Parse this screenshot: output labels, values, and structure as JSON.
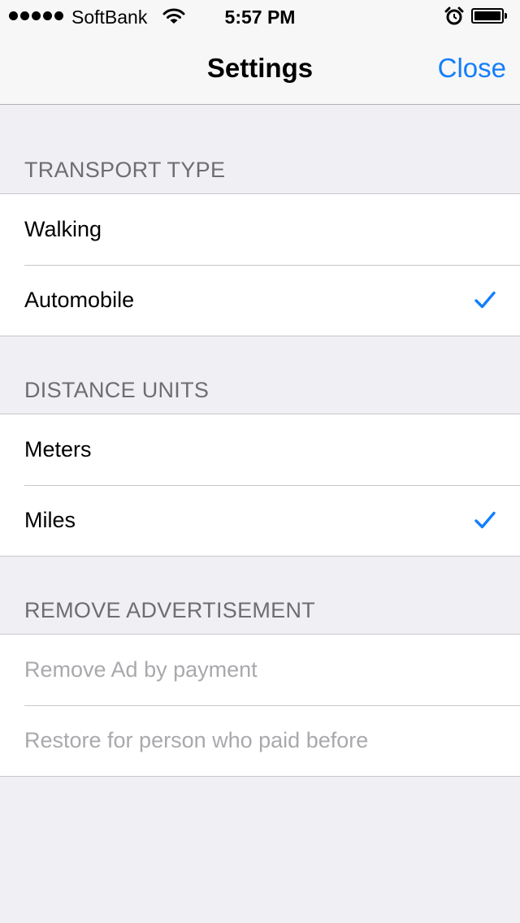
{
  "status_bar": {
    "carrier": "SoftBank",
    "time": "5:57 PM",
    "battery_level": 1.0
  },
  "nav": {
    "title": "Settings",
    "close_label": "Close"
  },
  "colors": {
    "accent": "#147efb",
    "background": "#efeff4",
    "section_header": "#6d6d72",
    "disabled_text": "#a9a9ad"
  },
  "sections": {
    "transport": {
      "header": "TRANSPORT TYPE",
      "items": [
        {
          "label": "Walking",
          "checked": false
        },
        {
          "label": "Automobile",
          "checked": true
        }
      ]
    },
    "distance": {
      "header": "DISTANCE UNITS",
      "items": [
        {
          "label": "Meters",
          "checked": false
        },
        {
          "label": "Miles",
          "checked": true
        }
      ]
    },
    "remove_ad": {
      "header": "REMOVE ADVERTISEMENT",
      "items": [
        {
          "label": "Remove Ad by payment",
          "disabled": true
        },
        {
          "label": "Restore for person who paid before",
          "disabled": true
        }
      ]
    }
  }
}
